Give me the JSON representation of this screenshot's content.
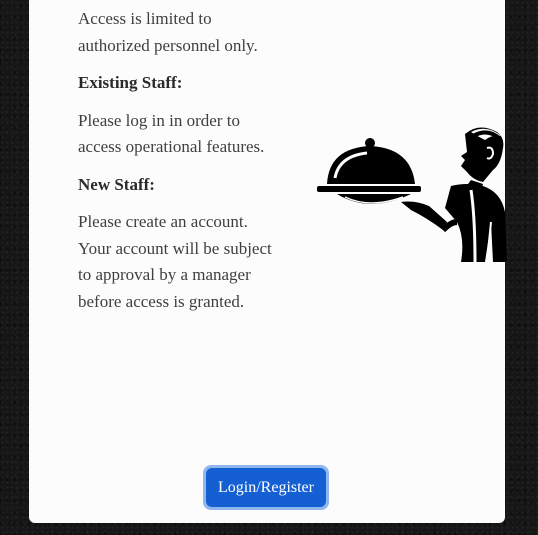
{
  "info": {
    "access_notice": "Access is limited to authorized personnel only.",
    "existing_heading": "Existing Staff:",
    "existing_text": "Please log in in order to access operational features.",
    "new_heading": "New Staff:",
    "new_text": "Please create an account. Your account will be subject to approval by a manager before access is granted."
  },
  "actions": {
    "login_register_label": "Login/Register"
  },
  "icons": {
    "illustration": "waiter-with-cloche-icon"
  },
  "colors": {
    "background": "#161616",
    "card": "#fcfcfc",
    "button": "#1460d2",
    "button_focus_ring": "#8fb7ee",
    "text": "#3f3f3f"
  }
}
